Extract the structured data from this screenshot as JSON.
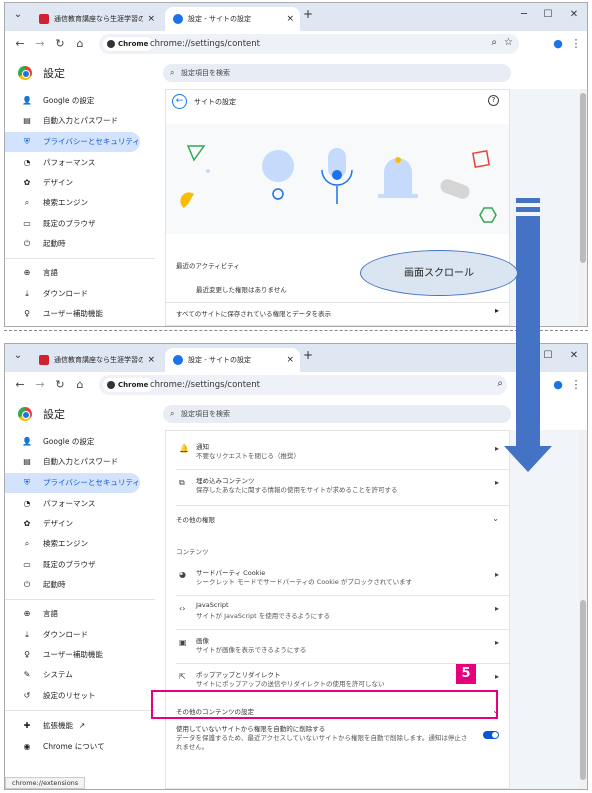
{
  "browser": {
    "tab1_title": "通信教育講座なら生涯学習のユ-",
    "tab2_title_top": "設定 - サイトの設定",
    "tab2_title_bottom": "設定 - サイトの設定",
    "new_tab": "+",
    "close_glyph": "×",
    "chrome_chip": "Chrome",
    "url": "chrome://settings/content",
    "status_url": "chrome://extensions"
  },
  "settings": {
    "title": "設定",
    "search_placeholder": "設定項目を検索"
  },
  "nav_top": [
    {
      "icon": "person-icon",
      "glyph": "👤",
      "label": "Google の設定"
    },
    {
      "icon": "clipboard-icon",
      "glyph": "▤",
      "label": "自動入力とパスワード"
    },
    {
      "icon": "shield-icon",
      "glyph": "⛨",
      "label": "プライバシーとセキュリティ"
    },
    {
      "icon": "speedometer-icon",
      "glyph": "◔",
      "label": "パフォーマンス"
    },
    {
      "icon": "palette-icon",
      "glyph": "✿",
      "label": "デザイン"
    },
    {
      "icon": "search-icon",
      "glyph": "⌕",
      "label": "検索エンジン"
    },
    {
      "icon": "browser-icon",
      "glyph": "▭",
      "label": "既定のブラウザ"
    },
    {
      "icon": "power-icon",
      "glyph": "⏻",
      "label": "起動時"
    },
    {
      "icon": "globe-icon",
      "glyph": "⊕",
      "label": "言語"
    },
    {
      "icon": "download-icon",
      "glyph": "⤓",
      "label": "ダウンロード"
    },
    {
      "icon": "accessibility-icon",
      "glyph": "♀",
      "label": "ユーザー補助機能"
    }
  ],
  "nav_bottom_extra": [
    {
      "icon": "wrench-icon",
      "glyph": "✎",
      "label": "システム"
    },
    {
      "icon": "reset-icon",
      "glyph": "↺",
      "label": "設定のリセット"
    },
    {
      "icon": "puzzle-icon",
      "glyph": "✚",
      "label": "拡張機能"
    },
    {
      "icon": "chrome-icon",
      "glyph": "◉",
      "label": "Chrome について"
    }
  ],
  "top_page": {
    "back_title": "サイトの設定",
    "help_glyph": "?",
    "recent_activity_heading": "最近のアクティビティ",
    "recent_empty": "最近変更した権限はありません",
    "all_sites": "すべてのサイトに保存されている権限とデータを表示"
  },
  "callout": "画面スクロール",
  "step_badge": "5",
  "bottom_page": {
    "rows": [
      {
        "icon": "bell-icon",
        "glyph": "🔔",
        "title": "通知",
        "sub": "不要なリクエストを閉じる（推奨）"
      },
      {
        "icon": "embed-icon",
        "glyph": "⧉",
        "title": "埋め込みコンテンツ",
        "sub": "保存したあなたに関する情報の使用をサイトが求めることを許可する"
      }
    ],
    "other_permissions": "その他の権限",
    "content_heading": "コンテンツ",
    "content_rows": [
      {
        "icon": "cookie-icon",
        "glyph": "◕",
        "title": "サードパーティ Cookie",
        "sub": "シークレット モードでサードパーティの Cookie がブロックされています"
      },
      {
        "icon": "code-icon",
        "glyph": "‹›",
        "title": "JavaScript",
        "sub": "サイトが JavaScript を使用できるようにする"
      },
      {
        "icon": "image-icon",
        "glyph": "▣",
        "title": "画像",
        "sub": "サイトが画像を表示できるようにする"
      },
      {
        "icon": "popup-icon",
        "glyph": "⇱",
        "title": "ポップアップとリダイレクト",
        "sub": "サイトにポップアップの送信やリダイレクトの使用を許可しない"
      }
    ],
    "more_content": "その他のコンテンツの設定",
    "auto_remove_title": "使用していないサイトから権限を自動的に削除する",
    "auto_remove_sub1": "データを保護するため、最近アクセスしていないサイトから権限を自動で削除します。通知は停止さ",
    "auto_remove_sub2": "れません。",
    "toggle_on": true
  },
  "colors": {
    "accent": "#1a73e8",
    "highlight": "#e6007e",
    "arrow": "#4472c4",
    "callout_bg": "#dbe5f1"
  }
}
